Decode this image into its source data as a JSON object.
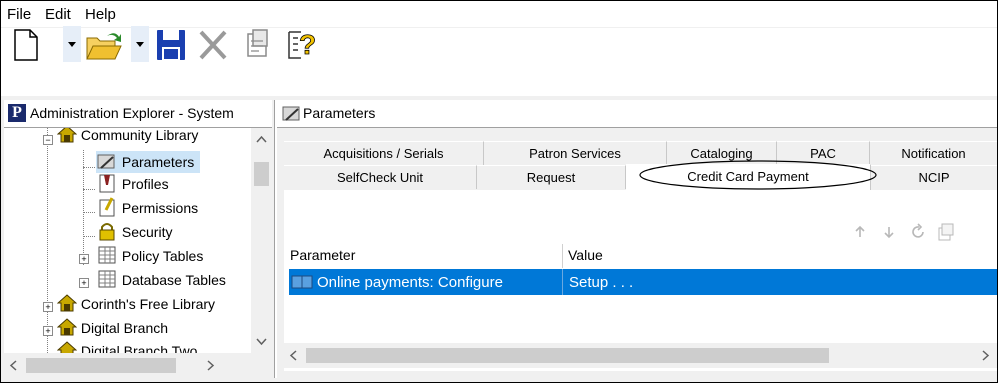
{
  "menu": {
    "file": "File",
    "edit": "Edit",
    "help": "Help"
  },
  "toolbar": {
    "new_icon": "new-document-icon",
    "open_icon": "open-folder-icon",
    "save_icon": "save-disk-icon",
    "delete_icon": "delete-x-icon",
    "properties_icon": "properties-icon",
    "help_icon": "whats-this-help-icon"
  },
  "explorer": {
    "header_badge": "P",
    "header_title": "Administration Explorer - System",
    "tree": [
      {
        "label": "Community Library"
      },
      {
        "label": "Parameters"
      },
      {
        "label": "Profiles"
      },
      {
        "label": "Permissions"
      },
      {
        "label": "Security"
      },
      {
        "label": "Policy Tables"
      },
      {
        "label": "Database Tables"
      },
      {
        "label": "Corinth's Free Library"
      },
      {
        "label": "Digital Branch"
      },
      {
        "label": "Digital Branch Two"
      }
    ]
  },
  "parameters": {
    "header_title": "Parameters",
    "tabs_row1": [
      "Acquisitions / Serials",
      "Patron Services",
      "Cataloging",
      "PAC",
      "Notification"
    ],
    "tabs_row2": [
      "SelfCheck Unit",
      "Request",
      "Credit Card Payment",
      "NCIP"
    ],
    "active_tab": "Credit Card Payment",
    "columns": {
      "parameter": "Parameter",
      "value": "Value"
    },
    "rows": [
      {
        "parameter": "Online payments: Configure",
        "value": "Setup . . ."
      }
    ],
    "accent": "#0078d7"
  }
}
